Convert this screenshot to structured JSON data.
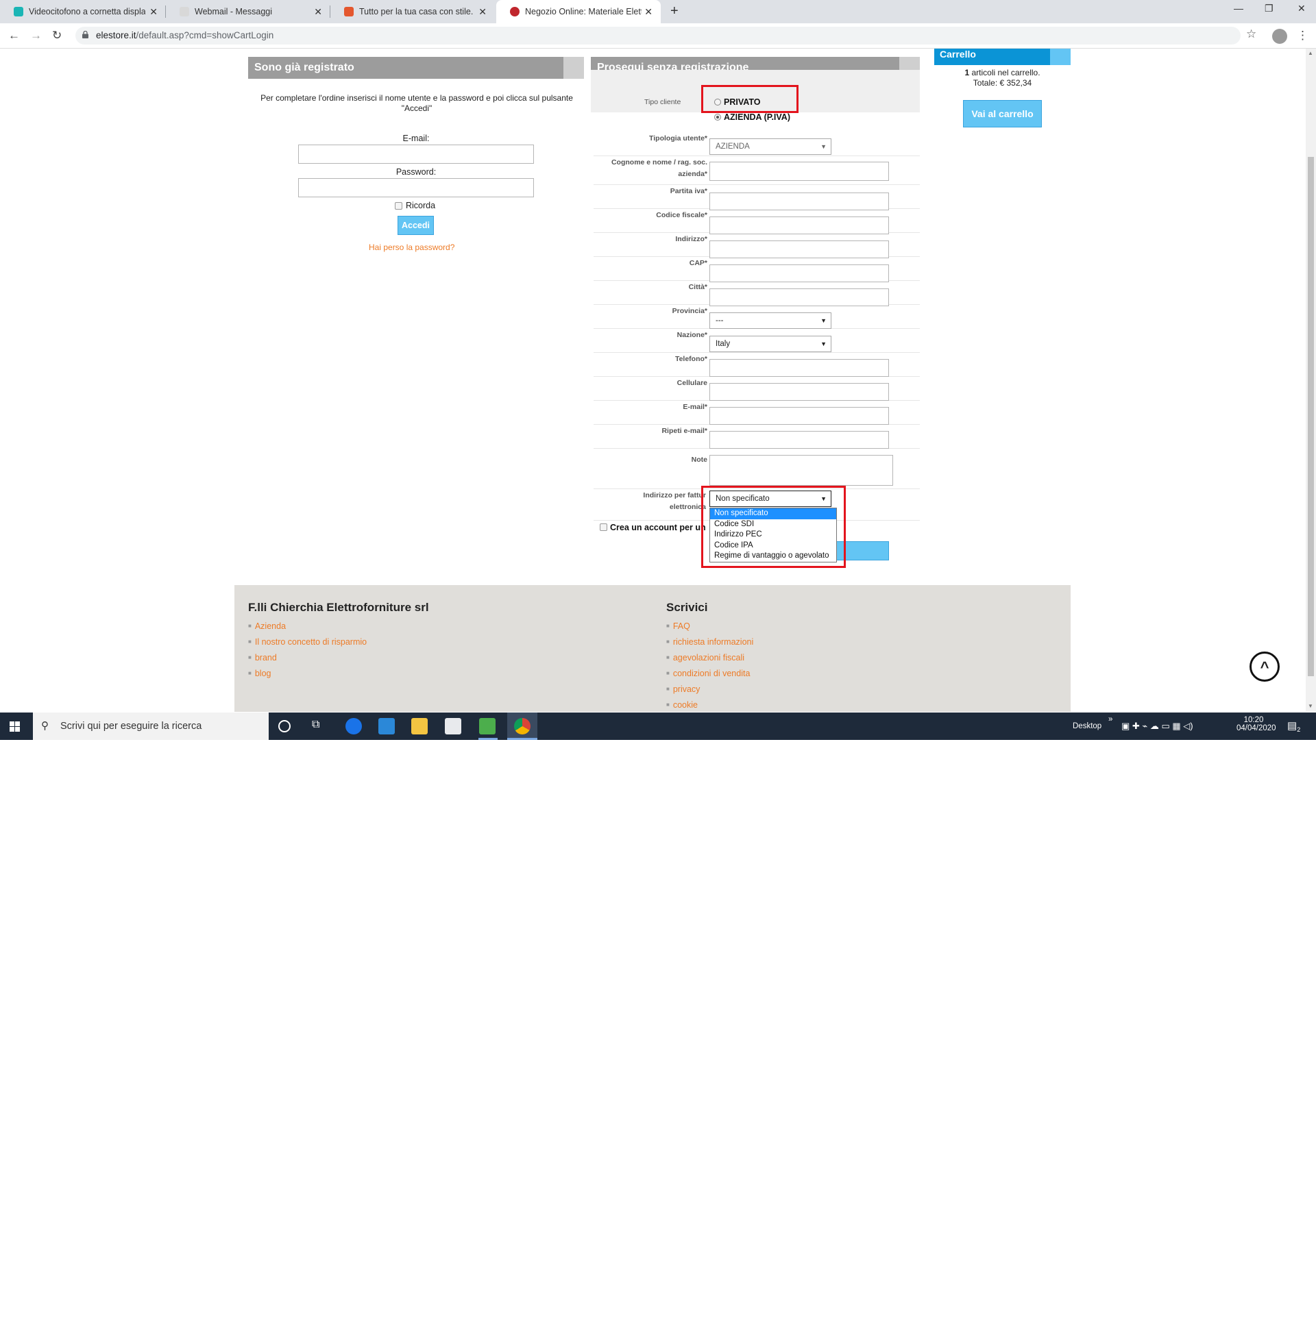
{
  "browser": {
    "tabs": [
      {
        "title": "Videocitofono a cornetta display",
        "color": "#1bb5b5"
      },
      {
        "title": "Webmail - Messaggi",
        "color": "#d8d8d8"
      },
      {
        "title": "Tutto per la tua casa con stile. Sc",
        "color": "#e4572e"
      },
      {
        "title": "Negozio Online: Materiale Elettri",
        "color": "#c0262d"
      }
    ],
    "url_host": "elestore.it",
    "url_path": "/default.asp?cmd=showCartLogin"
  },
  "login": {
    "header": "Sono già registrato",
    "instructions": "Per completare l'ordine inserisci il nome utente e la password e poi clicca sul pulsante \"Accedi\"",
    "email_label": "E-mail:",
    "password_label": "Password:",
    "remember_label": "Ricorda",
    "submit_label": "Accedi",
    "forgot_link": "Hai perso la password?"
  },
  "guest": {
    "header": "Prosegui senza registrazione",
    "tipo_cliente_label": "Tipo cliente",
    "option_privato": "PRIVATO",
    "option_azienda": "AZIENDA (P.IVA)",
    "fields": {
      "tipologia": "Tipologia utente*",
      "tipologia_value": "AZIENDA",
      "cognome": "Cognome e nome / rag. soc. azienda*",
      "partita_iva": "Partita iva*",
      "codice_fiscale": "Codice fiscale*",
      "indirizzo": "Indirizzo*",
      "cap": "CAP*",
      "citta": "Città*",
      "provincia": "Provincia*",
      "provincia_value": "---",
      "nazione": "Nazione*",
      "nazione_value": "Italy",
      "telefono": "Telefono*",
      "cellulare": "Cellulare",
      "email": "E-mail*",
      "ripeti_email": "Ripeti e-mail*",
      "note": "Note",
      "fatturazione_line1": "Indirizzo per fattur",
      "fatturazione_line2": "elettronica",
      "fatturazione_value": "Non specificato"
    },
    "dropdown_options": [
      "Non specificato",
      "Codice SDI",
      "Indirizzo PEC",
      "Codice IPA",
      "Regime di vantaggio o agevolato"
    ],
    "crea_account": "Crea un account per un"
  },
  "cart": {
    "header": "Carrello",
    "count": "1",
    "count_suffix": " articoli nel carrello.",
    "total": "Totale: € 352,34",
    "button": "Vai al carrello"
  },
  "footer": {
    "company": "F.lli Chierchia Elettroforniture srl",
    "company_links": [
      "Azienda",
      "Il nostro concetto di risparmio",
      "brand",
      "blog"
    ],
    "scrivici": "Scrivici",
    "scrivici_links": [
      "FAQ",
      "richiesta informazioni",
      "agevolazioni fiscali",
      "condizioni di vendita",
      "privacy",
      "cookie"
    ]
  },
  "taskbar": {
    "search_placeholder": "Scrivi qui per eseguire la ricerca",
    "desktop_label": "Desktop",
    "time": "10:20",
    "date": "04/04/2020",
    "notification_count": "2"
  },
  "colors": {
    "accent_blue": "#63c5f4",
    "header_gray": "#9c9c9c",
    "link_orange": "#ed7b27",
    "highlight_red": "#e3141d"
  }
}
